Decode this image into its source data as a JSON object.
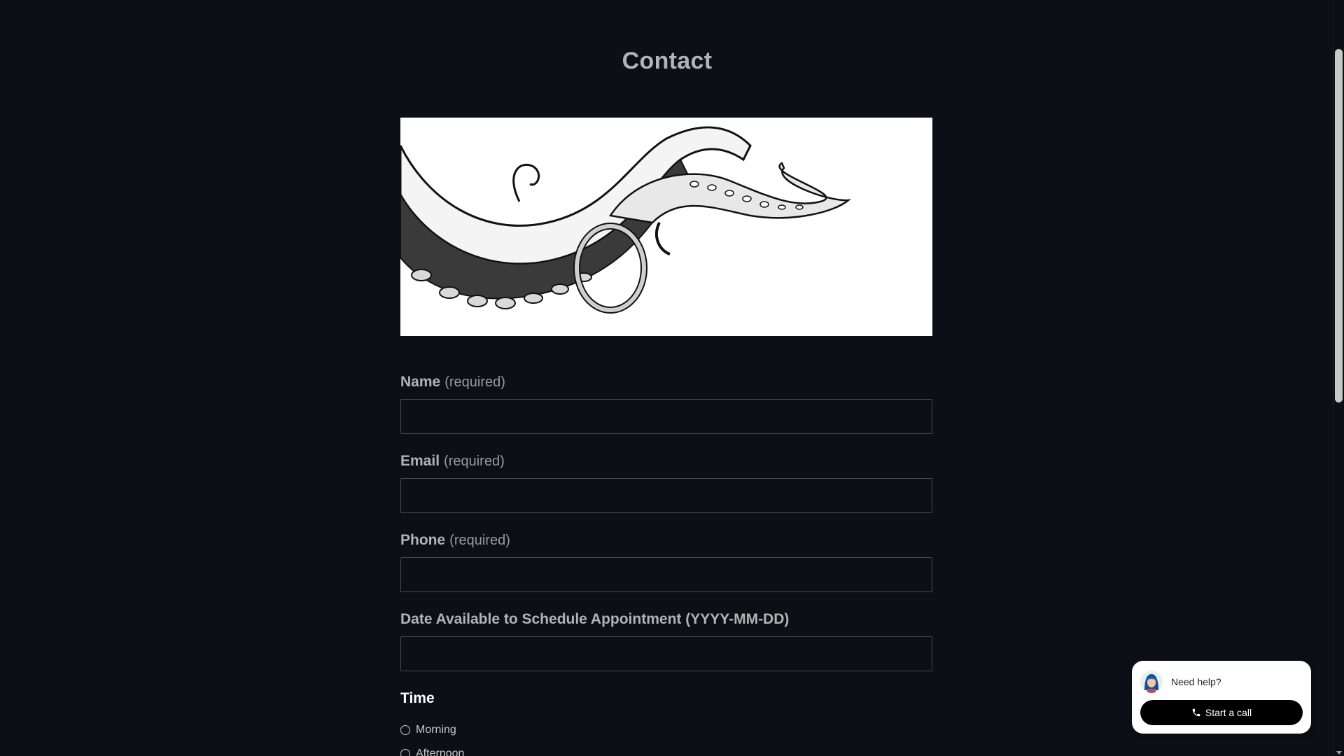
{
  "page": {
    "title": "Contact"
  },
  "form": {
    "fields": [
      {
        "label": "Name",
        "hint": "(required)",
        "value": ""
      },
      {
        "label": "Email",
        "hint": "(required)",
        "value": ""
      },
      {
        "label": "Phone",
        "hint": "(required)",
        "value": ""
      },
      {
        "label": "Date Available to Schedule Appointment (YYYY-MM-DD)",
        "hint": "",
        "value": ""
      }
    ],
    "time": {
      "label": "Time",
      "options": [
        "Morning",
        "Afternoon"
      ]
    }
  },
  "chat": {
    "prompt": "Need help?",
    "call_label": "Start a call",
    "icon": "phone-icon"
  },
  "colors": {
    "background": "#0d0f16",
    "label": "#b3b3b3",
    "input_border": "#4a4a4f",
    "widget_bg": "#ffffff",
    "call_button_bg": "#000000"
  }
}
